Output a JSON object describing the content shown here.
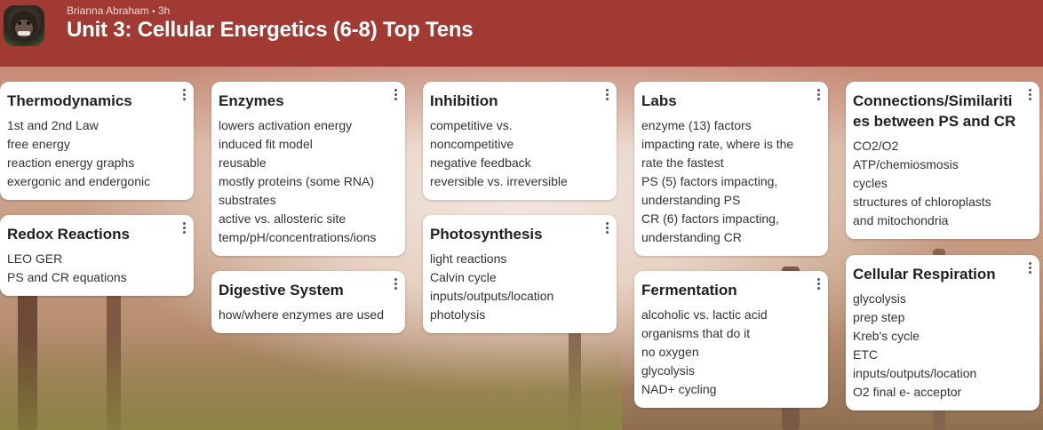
{
  "header": {
    "author": "Brianna Abraham",
    "separator": "•",
    "time": "3h",
    "title": "Unit 3: Cellular Energetics (6-8) Top Tens"
  },
  "columns": [
    {
      "cards": [
        {
          "title": "Thermodynamics",
          "body": "1st and 2nd Law\nfree energy\nreaction energy graphs\nexergonic and endergonic"
        },
        {
          "title": "Redox Reactions",
          "body": "LEO GER\nPS and CR equations"
        }
      ]
    },
    {
      "cards": [
        {
          "title": "Enzymes",
          "body": "lowers activation energy\ninduced fit model\nreusable\nmostly proteins (some RNA)\nsubstrates\nactive vs. allosteric site\ntemp/pH/concentrations/ions"
        },
        {
          "title": "Digestive System",
          "body": "how/where enzymes are used"
        }
      ]
    },
    {
      "cards": [
        {
          "title": "Inhibition",
          "body": "competitive vs.\nnoncompetitive\nnegative feedback\nreversible vs. irreversible"
        },
        {
          "title": "Photosynthesis",
          "body": "light reactions\nCalvin cycle\ninputs/outputs/location\nphotolysis"
        }
      ]
    },
    {
      "cards": [
        {
          "title": "Labs",
          "body": "enzyme (13) factors\nimpacting rate, where is the\nrate the fastest\nPS (5) factors impacting,\nunderstanding PS\nCR (6) factors impacting,\nunderstanding CR"
        },
        {
          "title": "Fermentation",
          "body": "alcoholic vs. lactic acid\norganisms that do it\nno oxygen\nglycolysis\nNAD+ cycling"
        }
      ]
    },
    {
      "cards": [
        {
          "title": "Connections/Similarities between PS and CR",
          "body": "CO2/O2\nATP/chemiosmosis\ncycles\nstructures of chloroplasts\nand mitochondria"
        },
        {
          "title": "Cellular Respiration",
          "body": "glycolysis\nprep step\nKreb's cycle\nETC\ninputs/outputs/location\nO2 final e- acceptor"
        }
      ]
    }
  ]
}
